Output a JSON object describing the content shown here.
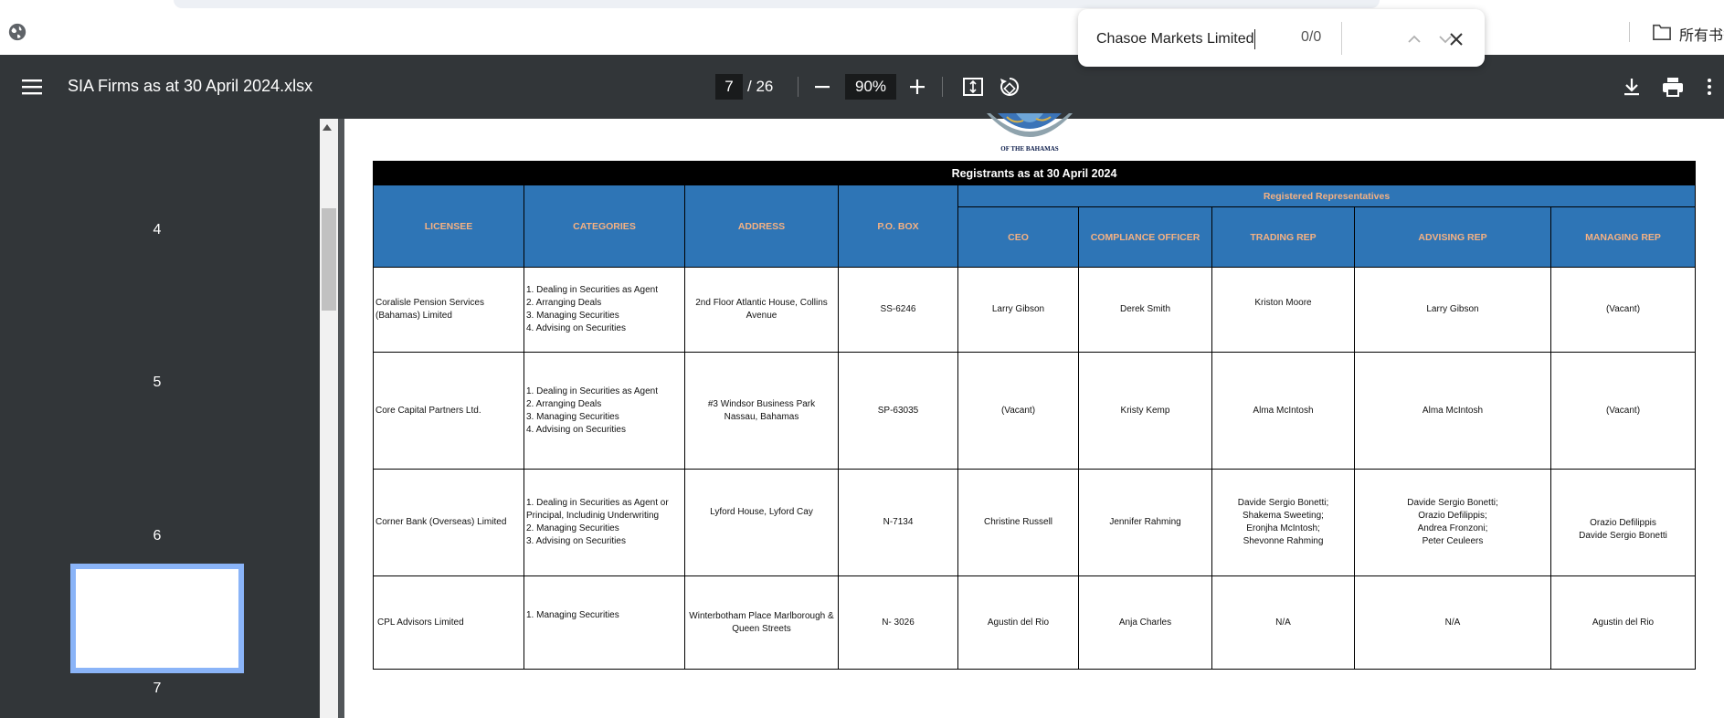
{
  "browser": {
    "bookmarks_label": "所有书签"
  },
  "find_bar": {
    "query": "Chasoe Markets Limited",
    "count": "0/0"
  },
  "toolbar": {
    "title": "SIA Firms as at 30 April 2024.xlsx",
    "current_page": "7",
    "page_total": "/ 26",
    "zoom": "90%"
  },
  "sidebar": {
    "thumbnails": [
      {
        "label": "4"
      },
      {
        "label": "5"
      },
      {
        "label": "6"
      },
      {
        "label": "7",
        "selected": true
      }
    ],
    "accent_color": "#8ab4f8"
  },
  "logo": {
    "text": "OF THE BAHAMAS"
  },
  "sheet": {
    "caption": "Registrants as at 30 April 2024",
    "group_header": "Registered Representatives",
    "header_bg": "#2e75b6",
    "header_text_color": "#f4b183",
    "columns": {
      "licensee": "LICENSEE",
      "categories": "CATEGORIES",
      "address": "ADDRESS",
      "po_box": "P.O. BOX",
      "ceo": "CEO",
      "compliance": "COMPLIANCE OFFICER",
      "trading": "TRADING REP",
      "advising": "ADVISING REP",
      "managing": "MANAGING REP"
    },
    "rows": [
      {
        "licensee": "Coralisle Pension Services\n(Bahamas) Limited",
        "categories": "1. Dealing in Securities as Agent\n2. Arranging Deals\n3. Managing Securities\n4. Advising on Securities",
        "address": "2nd Floor Atlantic House, Collins\nAvenue",
        "po_box": "SS-6246",
        "ceo": "Larry Gibson",
        "compliance": "Derek Smith",
        "trading": "Kriston Moore",
        "advising": "Larry Gibson",
        "managing": "(Vacant)"
      },
      {
        "licensee": "Core Capital Partners Ltd.",
        "categories": "1. Dealing in Securities as Agent\n2. Arranging Deals\n3. Managing Securities\n4. Advising on Securities",
        "address": "#3 Windsor Business Park\nNassau, Bahamas",
        "po_box": "SP-63035",
        "ceo": "(Vacant)",
        "compliance": "Kristy Kemp",
        "trading": "Alma McIntosh",
        "advising": "Alma McIntosh",
        "managing": "(Vacant)"
      },
      {
        "licensee": "Corner Bank (Overseas) Limited",
        "categories": "1. Dealing in Securities as Agent or\nPrincipal, Includinig Underwriting\n2. Managing Securities\n3. Advising on Securities",
        "address": "Lyford House, Lyford Cay",
        "po_box": "N-7134",
        "ceo": "Christine Russell",
        "compliance": "Jennifer Rahming",
        "trading": "Davide Sergio Bonetti;\nShakema Sweeting;\nEronjha McIntosh;\nShevonne Rahming",
        "advising": "Davide Sergio Bonetti;\nOrazio Defilippis;\nAndrea Fronzoni;\nPeter Ceuleers",
        "managing": "Orazio Defilippis\nDavide Sergio Bonetti"
      },
      {
        "licensee": "CPL Advisors Limited",
        "categories": "1. Managing Securities",
        "address": "Winterbotham Place Marlborough &\nQueen Streets",
        "po_box": "N- 3026",
        "ceo": "Agustin del Rio",
        "compliance": "Anja Charles",
        "trading": "N/A",
        "advising": "N/A",
        "managing": "Agustin del Rio"
      }
    ]
  }
}
